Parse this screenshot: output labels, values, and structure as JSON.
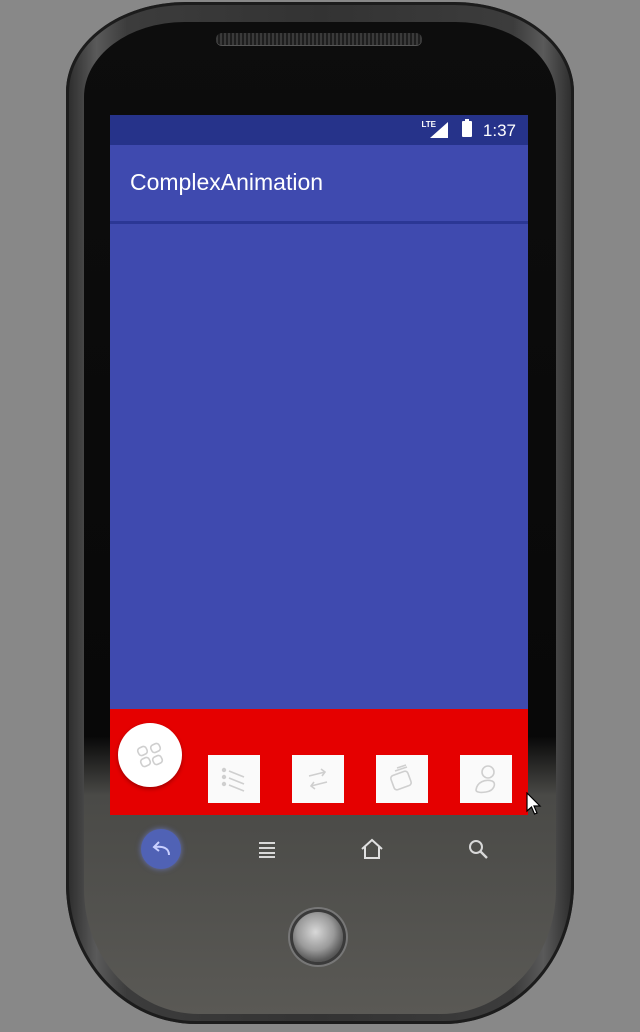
{
  "status_bar": {
    "network_label": "LTE",
    "time": "1:37"
  },
  "app_bar": {
    "title": "ComplexAnimation"
  },
  "bottom_panel": {
    "fab_icon": "grid-apps-icon",
    "tiles": [
      {
        "icon": "list-icon"
      },
      {
        "icon": "swap-arrows-icon"
      },
      {
        "icon": "cards-icon"
      },
      {
        "icon": "person-icon"
      }
    ]
  },
  "nav_bar": {
    "icons": [
      "back-icon",
      "menu-icon",
      "home-icon",
      "search-icon"
    ]
  },
  "colors": {
    "status_bar": "#26338a",
    "primary": "#3f4aaf",
    "panel": "#e50000",
    "tile": "#fafafa"
  }
}
